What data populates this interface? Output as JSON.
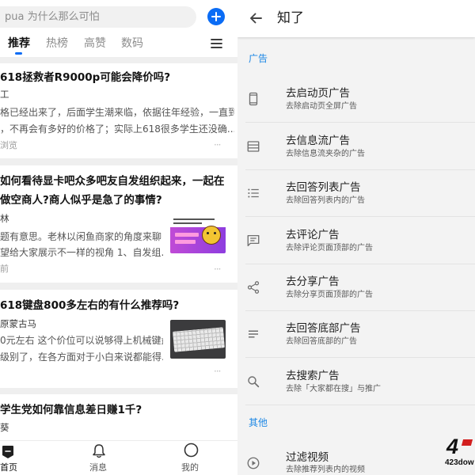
{
  "left": {
    "search_text": "pua 为什么那么可怕",
    "add_icon": "plus-icon",
    "menu_icon": "menu-icon",
    "tabs": [
      {
        "label": "推荐",
        "active": true
      },
      {
        "label": "热榜"
      },
      {
        "label": "高赞"
      },
      {
        "label": "数码"
      }
    ],
    "feed": [
      {
        "title": [
          "618拯救者R9000p可能会降价吗?"
        ],
        "author": "工",
        "excerpt": [
          "格已经出来了，后面学生潮来临，依据往年经验，一直到",
          "，不再会有多好的价格了；实际上618很多学生还没确..."
        ],
        "meta": "浏览",
        "more": "···"
      },
      {
        "title": [
          "如何看待显卡吧众多吧友自发组织起来，一起在",
          "做空商人?商人似乎是急了的事情?"
        ],
        "author": "林",
        "excerpt": [
          "题有意思。老林以闲鱼商家的角度来聊",
          "望给大家展示不一样的视角 1、自发组..."
        ],
        "meta": "前",
        "more": "···"
      },
      {
        "title": [
          "618键盘800多左右的有什么推荐吗?"
        ],
        "author": "原蒙古马",
        "excerpt": [
          "0元左右 这个价位可以说够得上机械键盘",
          "级别了，在各方面对于小白来说都能得..."
        ],
        "more": "···"
      },
      {
        "title": [
          "学生党如何靠信息差日赚1千?"
        ],
        "author": "葵"
      }
    ],
    "bottom_nav": [
      {
        "label": "首页",
        "icon": "home-icon",
        "active": true
      },
      {
        "label": "消息",
        "icon": "bell-icon"
      },
      {
        "label": "我的",
        "icon": "profile-icon"
      }
    ]
  },
  "right": {
    "header": {
      "title": "知了",
      "back_icon": "arrow-back-icon"
    },
    "sections": [
      {
        "title": "广告",
        "items": [
          {
            "icon": "phone-icon",
            "title": "去启动页广告",
            "subtitle": "去除启动页全屏广告"
          },
          {
            "icon": "feed-icon",
            "title": "去信息流广告",
            "subtitle": "去除信息流夹杂的广告"
          },
          {
            "icon": "list-icon",
            "title": "去回答列表广告",
            "subtitle": "去除回答列表内的广告"
          },
          {
            "icon": "comment-icon",
            "title": "去评论广告",
            "subtitle": "去除评论页面顶部的广告"
          },
          {
            "icon": "share-icon",
            "title": "去分享广告",
            "subtitle": "去除分享页面顶部的广告"
          },
          {
            "icon": "notes-icon",
            "title": "去回答底部广告",
            "subtitle": "去除回答底部的广告"
          },
          {
            "icon": "search-icon",
            "title": "去搜索广告",
            "subtitle": "去除「大家都在搜」与推广"
          }
        ]
      },
      {
        "title": "其他",
        "items": [
          {
            "icon": "play-circle-icon",
            "title": "过滤视频",
            "subtitle": "去除推荐列表内的视频"
          }
        ]
      }
    ]
  },
  "watermark": {
    "mark": "4",
    "text": "423dow"
  },
  "colors": {
    "accent_blue": "#0a6cf5",
    "section_blue": "#1e88e5",
    "text_dark": "#121212",
    "text_gray": "#8c8c8c"
  }
}
